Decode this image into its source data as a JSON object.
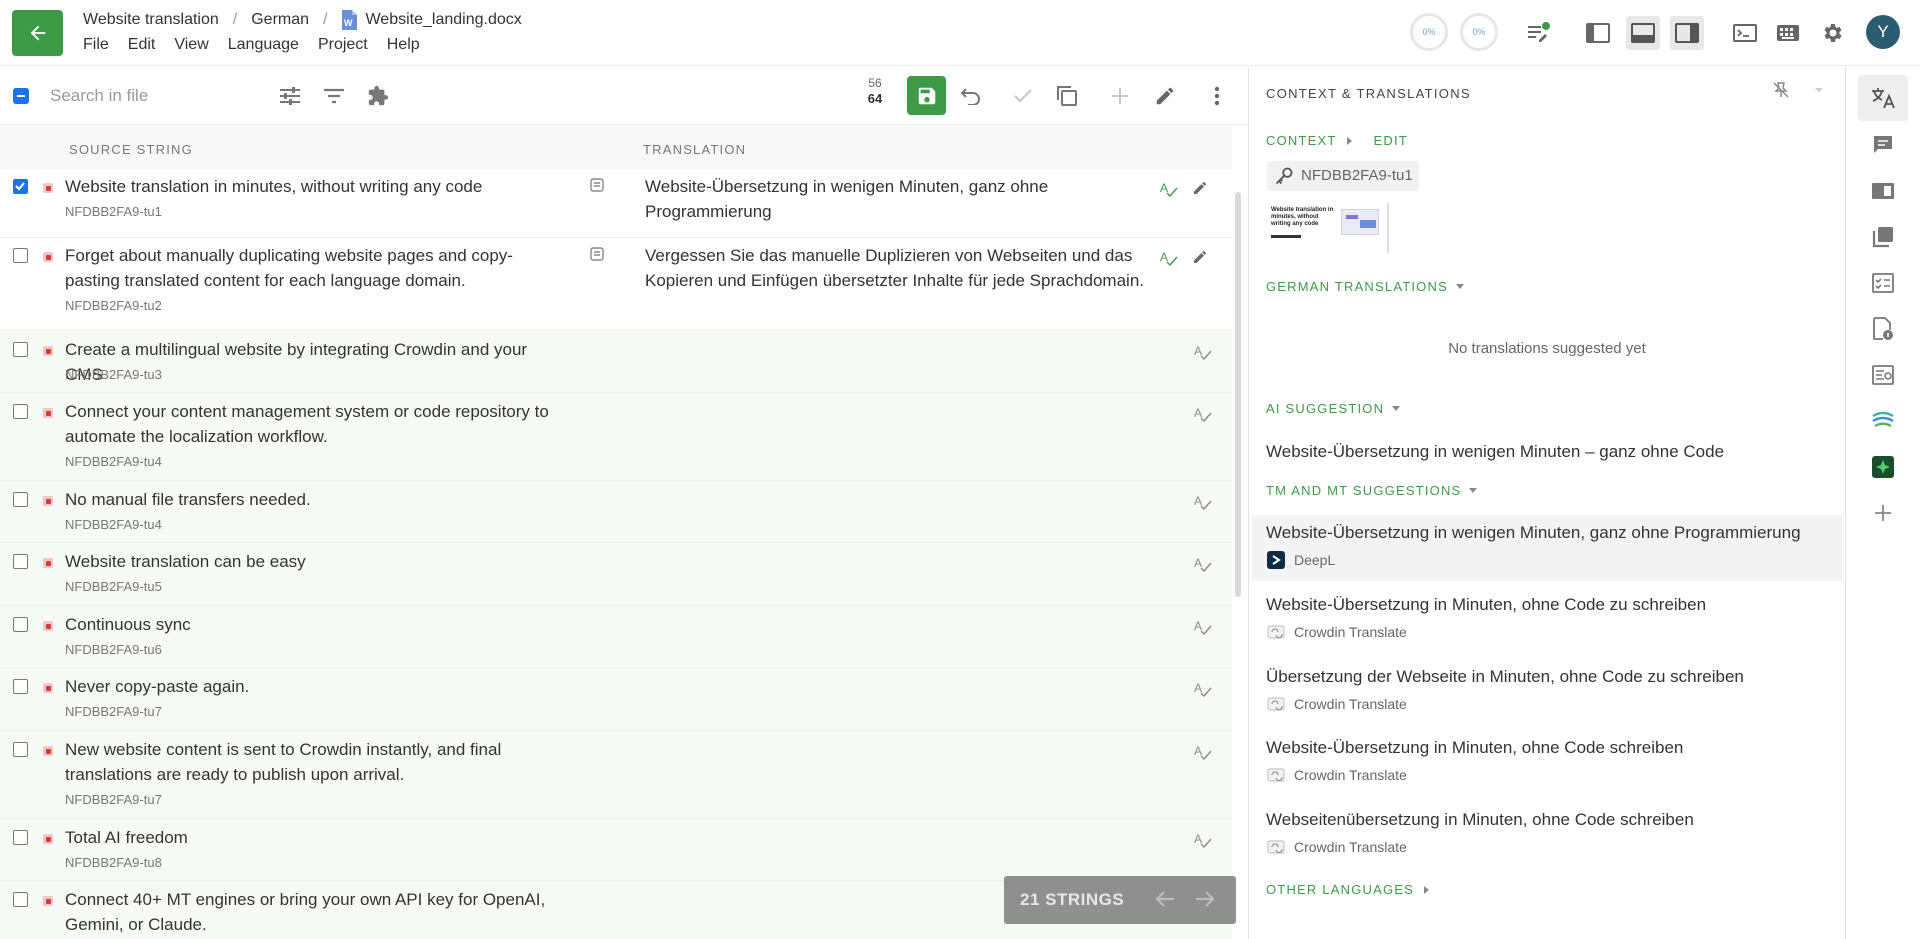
{
  "header": {
    "breadcrumb": {
      "project": "Website translation",
      "language": "German",
      "file": "Website_landing.docx"
    },
    "menu": [
      "File",
      "Edit",
      "View",
      "Language",
      "Project",
      "Help"
    ],
    "progress": {
      "translated": "0%",
      "approved": "0%"
    },
    "avatar_initial": "Y",
    "accent_color": "#3d9b48"
  },
  "toolbar": {
    "search_placeholder": "Search in file",
    "counter_top": "56",
    "counter_bottom": "64"
  },
  "columns": {
    "source": "SOURCE STRING",
    "translation": "TRANSLATION"
  },
  "rows": [
    {
      "source": "Website translation in minutes, without writing any code",
      "key": "NFDBB2FA9-tu1",
      "translation": "Website-Übersetzung in wenigen Minuten, ganz ohne Programmierung",
      "checked": true
    },
    {
      "source": "Forget about manually duplicating website pages and copy-pasting translated content for each language domain.",
      "key": "NFDBB2FA9-tu2",
      "translation": "Vergessen Sie das manuelle Duplizieren von Webseiten und das Kopieren und Einfügen übersetzter Inhalte für jede Sprachdomain.",
      "checked": false
    },
    {
      "source": "Create a multilingual website by integrating Crowdin and your CMS",
      "key": "NFDBB2FA9-tu3",
      "translation": "",
      "checked": false
    },
    {
      "source": "Connect your content management system or code repository to automate the localization workflow.",
      "key": "NFDBB2FA9-tu4",
      "translation": "",
      "checked": false
    },
    {
      "source": "No manual file transfers needed.",
      "key": "NFDBB2FA9-tu4",
      "translation": "",
      "checked": false
    },
    {
      "source": "Website translation can be easy",
      "key": "NFDBB2FA9-tu5",
      "translation": "",
      "checked": false
    },
    {
      "source": "Continuous sync",
      "key": "NFDBB2FA9-tu6",
      "translation": "",
      "checked": false
    },
    {
      "source": "Never copy-paste again.",
      "key": "NFDBB2FA9-tu7",
      "translation": "",
      "checked": false
    },
    {
      "source": "New website content is sent to Crowdin instantly, and final translations are ready to publish upon arrival.",
      "key": "NFDBB2FA9-tu7",
      "translation": "",
      "checked": false
    },
    {
      "source": "Total AI freedom",
      "key": "NFDBB2FA9-tu8",
      "translation": "",
      "checked": false
    },
    {
      "source": "Connect 40+ MT engines or bring your own API key for OpenAI, Gemini, or Claude.",
      "key": "",
      "translation": "",
      "checked": false
    }
  ],
  "strings_bar": {
    "label": "21 STRINGS"
  },
  "context_panel": {
    "title": "CONTEXT & TRANSLATIONS",
    "context_label": "CONTEXT",
    "edit_label": "EDIT",
    "key": "NFDBB2FA9-tu1",
    "thumb_text": "Website translation in minutes, without writing any code",
    "german_translations_label": "GERMAN TRANSLATIONS",
    "no_translations": "No translations suggested yet",
    "ai_suggestion_label": "AI SUGGESTION",
    "ai_suggestion": "Website-Übersetzung in wenigen Minuten – ganz ohne Code",
    "tm_mt_label": "TM AND MT SUGGESTIONS",
    "suggestions": [
      {
        "text": "Website-Übersetzung in wenigen Minuten, ganz ohne Programmierung",
        "engine": "DeepL"
      },
      {
        "text": "Website-Übersetzung in Minuten, ohne Code zu schreiben",
        "engine": "Crowdin Translate"
      },
      {
        "text": "Übersetzung der Webseite in Minuten, ohne Code zu schreiben",
        "engine": "Crowdin Translate"
      },
      {
        "text": "Website-Übersetzung in Minuten, ohne Code schreiben",
        "engine": "Crowdin Translate"
      },
      {
        "text": "Webseitenübersetzung in Minuten, ohne Code schreiben",
        "engine": "Crowdin Translate"
      }
    ],
    "other_languages_label": "OTHER LANGUAGES"
  }
}
